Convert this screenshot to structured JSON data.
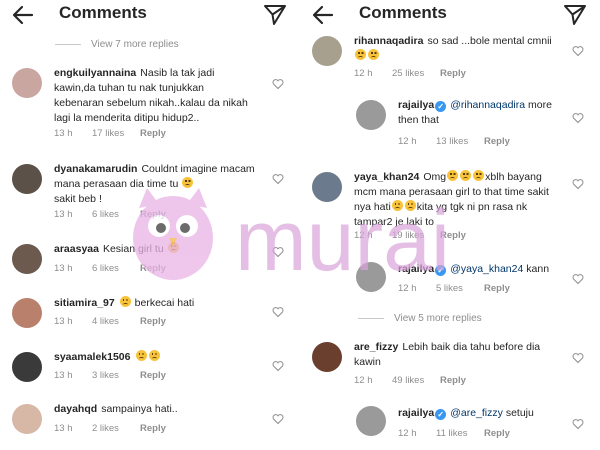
{
  "left": {
    "title": "Comments",
    "view_more": "View 7 more replies",
    "comments": [
      {
        "user": "engkuilyannaina",
        "text": "Nasib la tak jadi kawin,da tuhan tu nak tunjukkan kebenaran sebelum nikah..kalau da nikah lagi la menderita ditipu hidup2..",
        "time": "13 h",
        "likes": "17 likes",
        "reply": "Reply",
        "avatar_color": "#c9a6a0"
      },
      {
        "user": "dyanakamarudin",
        "text": "Couldnt imagine macam mana perasaan dia time tu",
        "text2": "sakit beb !",
        "time": "13 h",
        "likes": "6 likes",
        "reply": "Reply",
        "avatar_color": "#5b5148"
      },
      {
        "user": "araasyaa",
        "text": "Kesian girl tu",
        "time": "13 h",
        "likes": "6 likes",
        "reply": "Reply",
        "avatar_color": "#6d5a4f"
      },
      {
        "user": "sitiamira_97",
        "text": "berkecai hati",
        "time": "13 h",
        "likes": "4 likes",
        "reply": "Reply",
        "avatar_color": "#b9806b"
      },
      {
        "user": "syaamalek1506",
        "text": "",
        "time": "13 h",
        "likes": "3 likes",
        "reply": "Reply",
        "avatar_color": "#3a3a3a"
      },
      {
        "user": "dayahqd",
        "text": "sampainya hati..",
        "time": "13 h",
        "likes": "2 likes",
        "reply": "Reply",
        "avatar_color": "#d7b8a6"
      }
    ]
  },
  "right": {
    "title": "Comments",
    "view_more": "View 5 more replies",
    "comments": [
      {
        "user": "rihannaqadira",
        "text": "so sad ...bole mental cmnii",
        "time": "12 h",
        "likes": "25 likes",
        "reply": "Reply",
        "avatar_color": "#a7a08e"
      },
      {
        "user": "rajailya",
        "mention": "@rihannaqadira",
        "text": "more then that",
        "time": "12 h",
        "likes": "13 likes",
        "reply": "Reply",
        "avatar_color": "#9a9a9a"
      },
      {
        "user": "yaya_khan24",
        "text": "Omg",
        "text_b": "xblh bayang mcm mana perasaan girl to that time sakit nya hati",
        "text_c": "kita yg tgk ni pn rasa nk tampar2 je laki to",
        "time": "12 h",
        "likes": "19 likes",
        "reply": "Reply",
        "avatar_color": "#6b7a8c"
      },
      {
        "user": "rajailya",
        "mention": "@yaya_khan24",
        "text": "kann",
        "time": "12 h",
        "likes": "5 likes",
        "reply": "Reply",
        "avatar_color": "#9a9a9a"
      },
      {
        "user": "are_fizzy",
        "text": "Lebih baik dia tahu before dia kawin",
        "time": "12 h",
        "likes": "49 likes",
        "reply": "Reply",
        "avatar_color": "#6b3f2e"
      },
      {
        "user": "rajailya",
        "mention": "@are_fizzy",
        "text": "setuju",
        "time": "12 h",
        "likes": "11 likes",
        "reply": "Reply",
        "avatar_color": "#9a9a9a"
      }
    ]
  },
  "icons": {
    "back": "back-arrow-icon",
    "send": "send-icon",
    "heart": "heart-icon",
    "verified": "verified-badge-icon"
  },
  "watermark": {
    "text": "murai",
    "color": "#d9a3d9"
  }
}
